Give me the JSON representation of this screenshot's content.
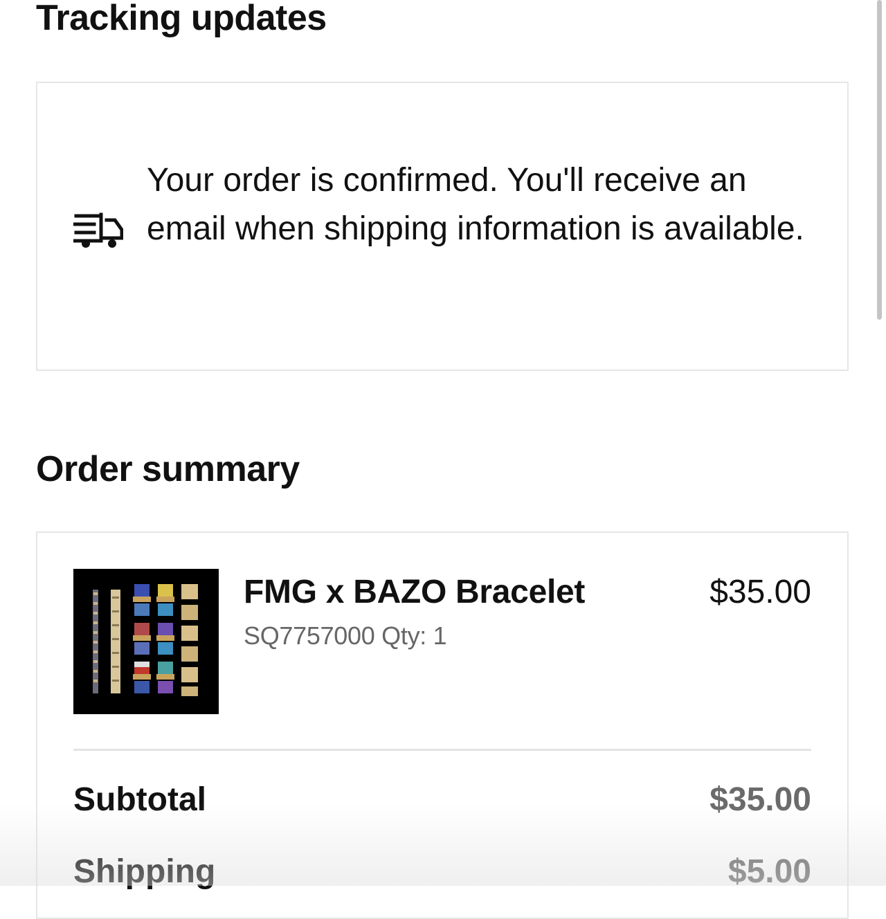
{
  "tracking": {
    "title": "Tracking updates",
    "icon": "truck-fast-icon",
    "message": "Your order is confirmed. You'll receive an email when shipping information is available."
  },
  "summary": {
    "title": "Order summary",
    "item": {
      "name": "FMG x BAZO Bracelet",
      "meta": "SQ7757000 Qty: 1",
      "price": "$35.00",
      "image": "bracelet-product-image"
    },
    "rows": [
      {
        "label": "Subtotal",
        "value": "$35.00"
      },
      {
        "label": "Shipping",
        "value": "$5.00"
      }
    ]
  },
  "colors": {
    "text": "#111111",
    "muted": "#666666",
    "border": "#e6e6e6"
  }
}
